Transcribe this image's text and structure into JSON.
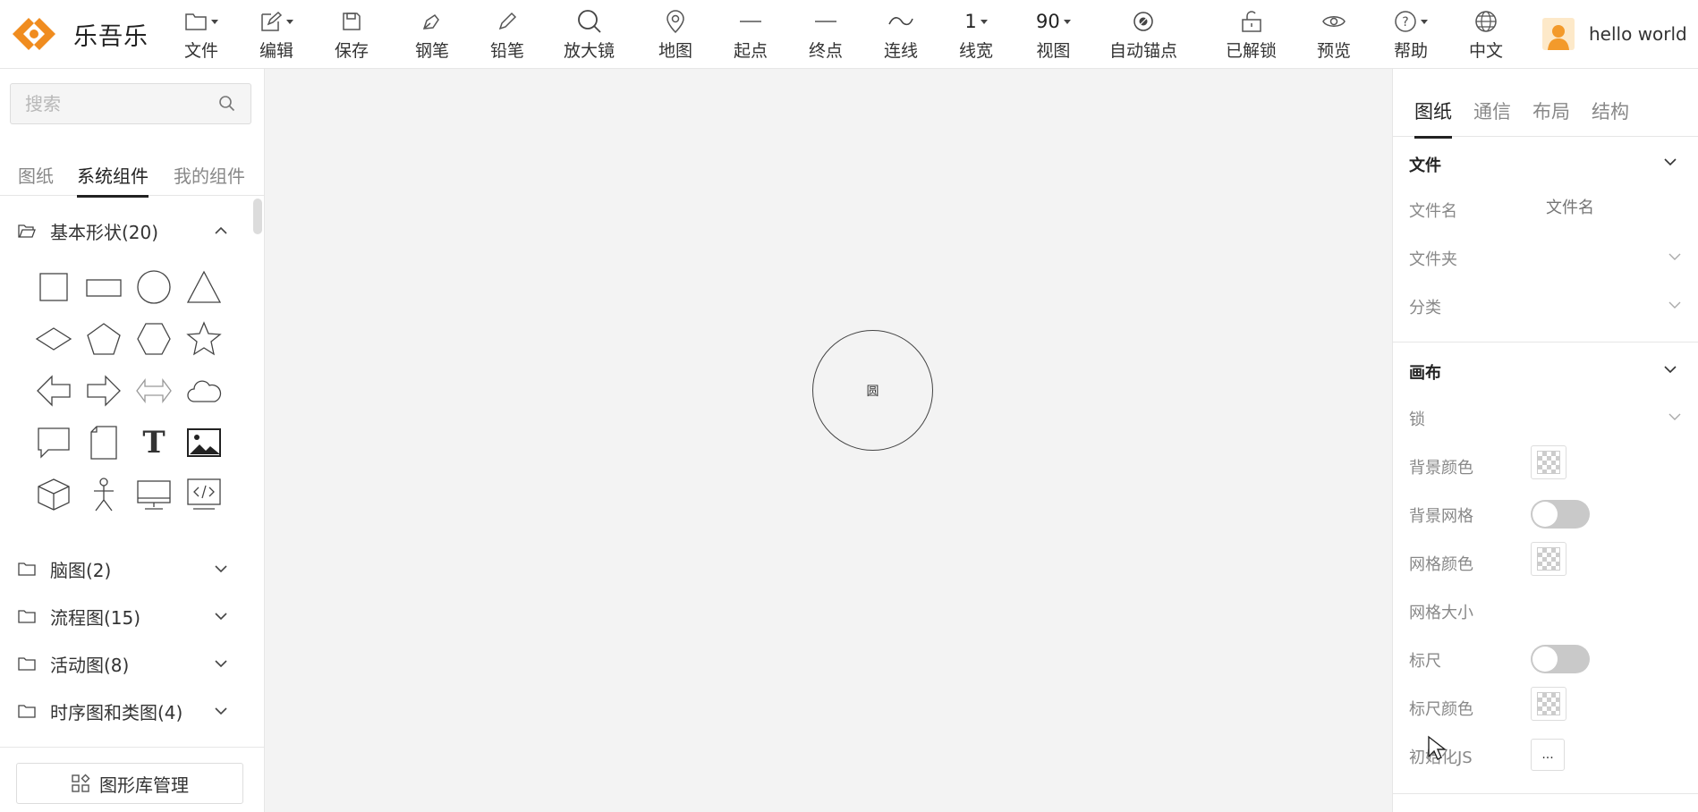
{
  "app": {
    "name": "乐吾乐"
  },
  "toolbar": {
    "file": "文件",
    "edit": "编辑",
    "save": "保存",
    "pen": "钢笔",
    "pencil": "铅笔",
    "magnifier": "放大镜",
    "map": "地图",
    "start": "起点",
    "end": "终点",
    "connect": "连线",
    "line_width_value": "1",
    "line_width": "线宽",
    "view_value": "90",
    "view": "视图",
    "auto_anchor": "自动锚点",
    "unlocked": "已解锁",
    "preview": "预览",
    "help": "帮助",
    "language": "中文"
  },
  "user": {
    "name": "hello world"
  },
  "left": {
    "search_placeholder": "搜索",
    "tabs": [
      "图纸",
      "系统组件",
      "我的组件"
    ],
    "categories": [
      {
        "label": "基本形状(20)",
        "expanded": true
      },
      {
        "label": "脑图(2)",
        "expanded": false
      },
      {
        "label": "流程图(15)",
        "expanded": false
      },
      {
        "label": "活动图(8)",
        "expanded": false
      },
      {
        "label": "时序图和类图(4)",
        "expanded": false
      }
    ],
    "shape_text_glyph": "T",
    "library_button": "图形库管理"
  },
  "canvas": {
    "node_text": "圆"
  },
  "right": {
    "tabs": [
      "图纸",
      "通信",
      "布局",
      "结构"
    ],
    "file_section": {
      "title": "文件",
      "filename_label": "文件名",
      "filename_placeholder": "文件名",
      "folder_label": "文件夹",
      "category_label": "分类"
    },
    "canvas_section": {
      "title": "画布",
      "lock_label": "锁",
      "bg_color_label": "背景颜色",
      "bg_grid_label": "背景网格",
      "grid_color_label": "网格颜色",
      "grid_size_label": "网格大小",
      "ruler_label": "标尺",
      "ruler_color_label": "标尺颜色",
      "init_js_label": "初始化JS",
      "init_js_button": "..."
    }
  },
  "colors": {
    "brand": "#f08c1f",
    "active": "#222222"
  }
}
